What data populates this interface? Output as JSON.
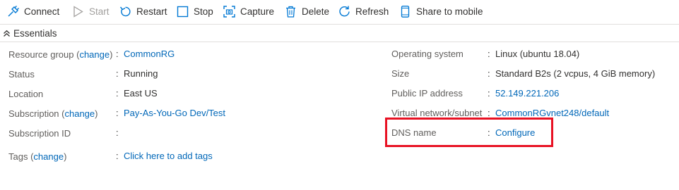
{
  "toolbar": {
    "connect": "Connect",
    "start": "Start",
    "restart": "Restart",
    "stop": "Stop",
    "capture": "Capture",
    "delete": "Delete",
    "refresh": "Refresh",
    "share": "Share to mobile"
  },
  "essentials": {
    "title": "Essentials",
    "left": {
      "resource_group": {
        "label_prefix": "Resource group (",
        "change": "change",
        "label_suffix": ")",
        "value": "CommonRG"
      },
      "status": {
        "label": "Status",
        "value": "Running"
      },
      "location": {
        "label": "Location",
        "value": "East US"
      },
      "subscription": {
        "label_prefix": "Subscription (",
        "change": "change",
        "label_suffix": ")",
        "value": "Pay-As-You-Go Dev/Test"
      },
      "subscription_id": {
        "label": "Subscription ID",
        "value": ""
      },
      "tags": {
        "label_prefix": "Tags (",
        "change": "change",
        "label_suffix": ")",
        "value": "Click here to add tags"
      }
    },
    "right": {
      "os": {
        "label": "Operating system",
        "value": "Linux (ubuntu 18.04)"
      },
      "size": {
        "label": "Size",
        "value": "Standard B2s (2 vcpus, 4 GiB memory)"
      },
      "public_ip": {
        "label": "Public IP address",
        "value": "52.149.221.206"
      },
      "vnet": {
        "label": "Virtual network/subnet",
        "value": "CommonRGvnet248/default"
      },
      "dns": {
        "label": "DNS name",
        "value": "Configure"
      }
    },
    "colon": ":"
  },
  "colors": {
    "link": "#0067b8",
    "highlight": "#e81123",
    "label": "#605e5c",
    "text": "#323130",
    "disabled": "#a19f9d"
  }
}
